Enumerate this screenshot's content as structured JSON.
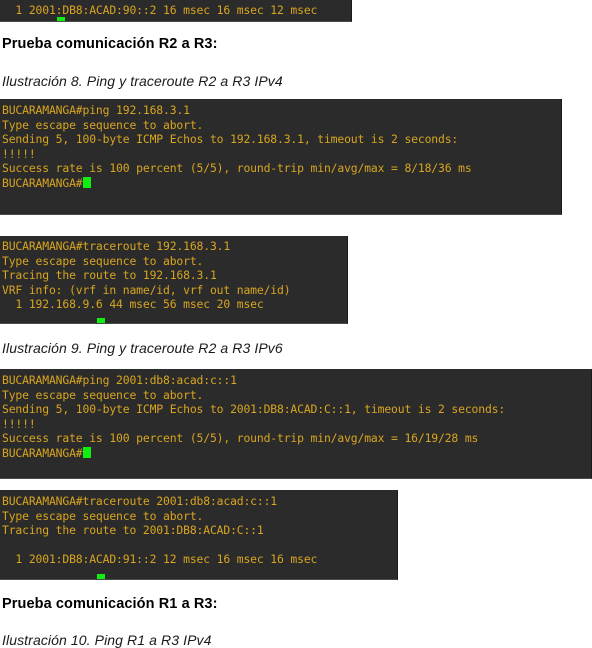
{
  "document": {
    "headings": [
      {
        "id": "heading-r2-r3",
        "text": "Prueba comunicación R2 a R3:"
      },
      {
        "id": "heading-r1-r3",
        "text": "Prueba comunicación R1 a R3:"
      }
    ],
    "captions": [
      {
        "id": "caption-8",
        "text": "Ilustración 8. Ping y traceroute R2 a R3 IPv4"
      },
      {
        "id": "caption-9",
        "text": "Ilustración 9. Ping y traceroute R2 a R3 IPv6"
      },
      {
        "id": "caption-10",
        "text": "Ilustración 10. Ping R1 a R3 IPv4"
      }
    ]
  },
  "colors": {
    "terminal_background": "#2b2b2b",
    "terminal_text": "#d8a520",
    "cursor": "#10ee10",
    "page_background": "#ffffff"
  },
  "terminals": [
    {
      "id": "terminal-traceroute-ipv6-top",
      "lines": [
        "  1 2001:DB8:ACAD:90::2 16 msec 16 msec 12 msec"
      ]
    },
    {
      "id": "terminal-ping-ipv4",
      "lines": [
        "BUCARAMANGA#ping 192.168.3.1",
        "Type escape sequence to abort.",
        "Sending 5, 100-byte ICMP Echos to 192.168.3.1, timeout is 2 seconds:",
        "!!!!!",
        "Success rate is 100 percent (5/5), round-trip min/avg/max = 8/18/36 ms",
        "BUCARAMANGA#"
      ]
    },
    {
      "id": "terminal-traceroute-ipv4",
      "lines": [
        "BUCARAMANGA#traceroute 192.168.3.1",
        "Type escape sequence to abort.",
        "Tracing the route to 192.168.3.1",
        "VRF info: (vrf in name/id, vrf out name/id)",
        "  1 192.168.9.6 44 msec 56 msec 20 msec"
      ]
    },
    {
      "id": "terminal-ping-ipv6",
      "lines": [
        "BUCARAMANGA#ping 2001:db8:acad:c::1",
        "Type escape sequence to abort.",
        "Sending 5, 100-byte ICMP Echos to 2001:DB8:ACAD:C::1, timeout is 2 seconds:",
        "!!!!!",
        "Success rate is 100 percent (5/5), round-trip min/avg/max = 16/19/28 ms",
        "BUCARAMANGA#"
      ]
    },
    {
      "id": "terminal-traceroute-ipv6",
      "lines": [
        "BUCARAMANGA#traceroute 2001:db8:acad:c::1",
        "Type escape sequence to abort.",
        "Tracing the route to 2001:DB8:ACAD:C::1",
        "",
        "  1 2001:DB8:ACAD:91::2 12 msec 16 msec 16 msec"
      ]
    }
  ]
}
